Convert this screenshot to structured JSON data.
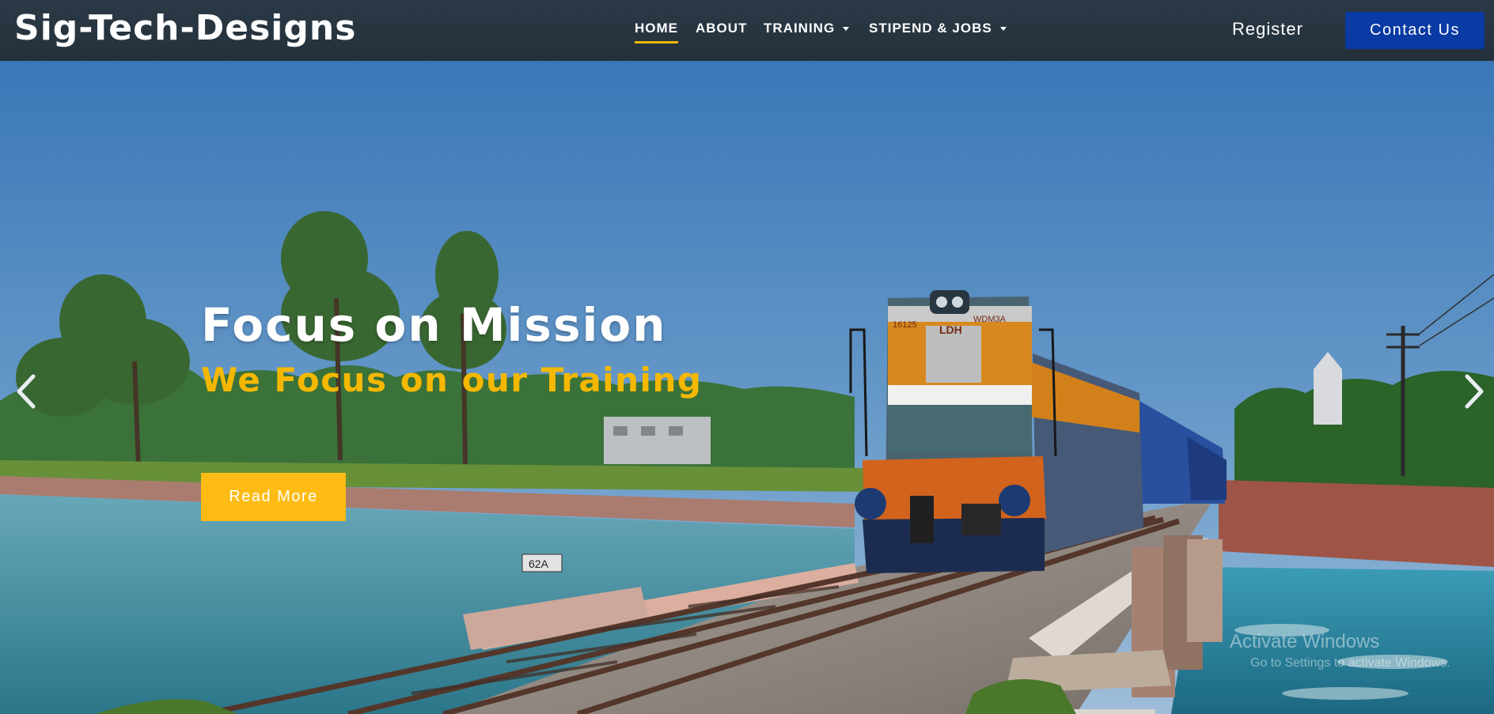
{
  "brand": {
    "name": "Sig-Tech-Designs"
  },
  "nav": {
    "items": [
      {
        "label": "HOME",
        "active": true,
        "dropdown": false
      },
      {
        "label": "ABOUT",
        "active": false,
        "dropdown": false
      },
      {
        "label": "TRAINING",
        "active": false,
        "dropdown": true
      },
      {
        "label": "STIPEND & JOBS",
        "active": false,
        "dropdown": true
      }
    ],
    "register_label": "Register",
    "contact_label": "Contact Us"
  },
  "hero": {
    "title": "Focus on Mission",
    "subtitle": "We Focus on our Training",
    "cta_label": "Read More",
    "prev_icon": "chevron-left-icon",
    "next_icon": "chevron-right-icon",
    "image_subject": "train-on-bridge-over-canal",
    "locomotive_labels": {
      "route": "LDH",
      "number_left": "16125",
      "number_right": "WDM3A"
    },
    "marker_stone": "62A"
  },
  "watermark": {
    "line1": "Activate Windows",
    "line2": "Go to Settings to activate Windows."
  },
  "colors": {
    "navbar": "#27343f",
    "accent_yellow": "#f5b800",
    "button_yellow": "#fdbb14",
    "contact_blue": "#0a3aa3"
  }
}
